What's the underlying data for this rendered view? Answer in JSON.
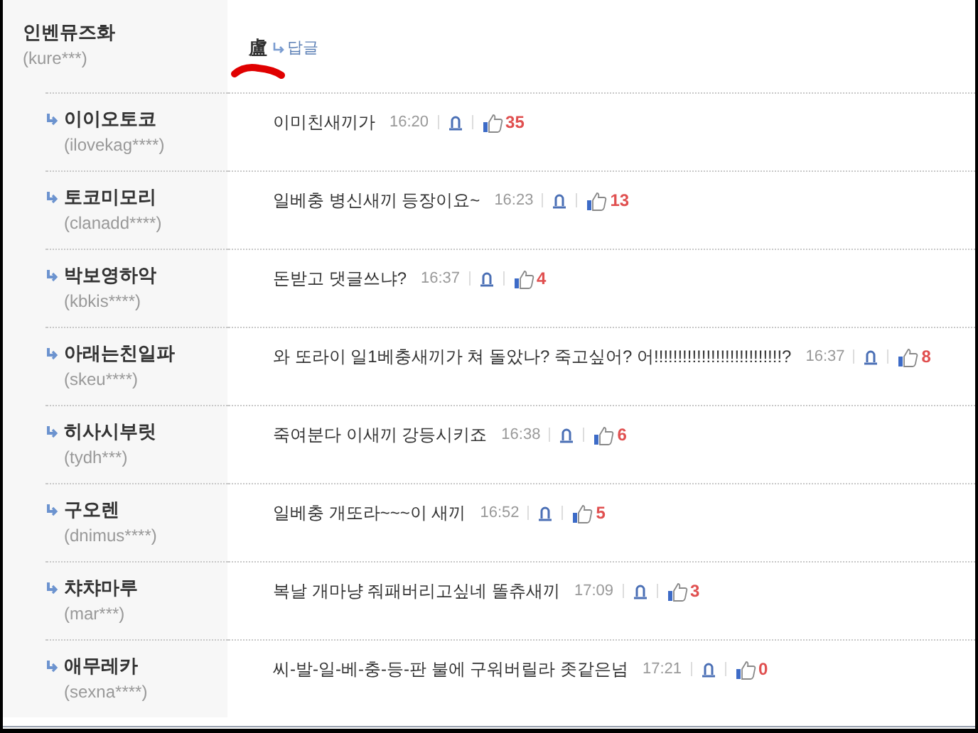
{
  "parent_comment": {
    "author": "인벤뮤즈화",
    "user_id": "(kure***)",
    "text": "盧",
    "reply_link": "답글",
    "highlighted": true
  },
  "replies": [
    {
      "author": "이이오토코",
      "user_id": "(ilovekag****)",
      "text": "이미친새끼가",
      "time": "16:20",
      "likes": "35"
    },
    {
      "author": "토코미모리",
      "user_id": "(clanadd****)",
      "text": "일베충 병신새끼 등장이요~",
      "time": "16:23",
      "likes": "13"
    },
    {
      "author": "박보영하악",
      "user_id": "(kbkis****)",
      "text": "돈받고 댓글쓰냐?",
      "time": "16:37",
      "likes": "4"
    },
    {
      "author": "아래는친일파",
      "user_id": "(skeu****)",
      "text": "와 또라이 일1베충새끼가 쳐 돌았나? 죽고싶어? 어!!!!!!!!!!!!!!!!!!!!!!!!!!!?",
      "time": "16:37",
      "likes": "8"
    },
    {
      "author": "히사시부릿",
      "user_id": "(tydh***)",
      "text": "죽여분다 이새끼 강등시키죠",
      "time": "16:38",
      "likes": "6"
    },
    {
      "author": "구오렌",
      "user_id": "(dnimus****)",
      "text": "일베충 개또라~~~이 새끼",
      "time": "16:52",
      "likes": "5"
    },
    {
      "author": "챠챠마루",
      "user_id": "(mar***)",
      "text": "복날 개마냥 줘패버리고싶네 똘츄새끼",
      "time": "17:09",
      "likes": "3"
    },
    {
      "author": "애무레카",
      "user_id": "(sexna****)",
      "text": "씨-발-일-베-충-등-판 불에 구워버릴라 좃같은넘",
      "time": "17:21",
      "likes": "0"
    }
  ]
}
